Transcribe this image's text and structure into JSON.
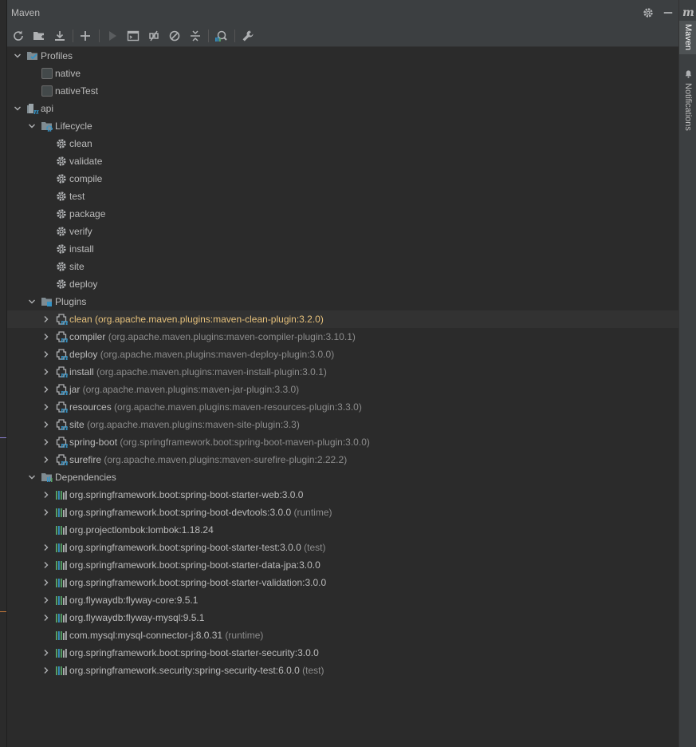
{
  "panel": {
    "title": "Maven",
    "settings_icon": "gear-icon",
    "minimize_icon": "minimize-icon"
  },
  "toolbar": [
    {
      "name": "reload-button",
      "icon": "reload-icon"
    },
    {
      "name": "add-project-button",
      "icon": "folder-add-icon"
    },
    {
      "name": "download-sources-button",
      "icon": "download-icon"
    },
    {
      "name": "add-maven-project-button",
      "icon": "plus-icon"
    },
    {
      "name": "run-button",
      "icon": "run-icon"
    },
    {
      "name": "execute-goal-button",
      "icon": "terminal-icon"
    },
    {
      "name": "toggle-offline-button",
      "icon": "offline-icon"
    },
    {
      "name": "skip-tests-button",
      "icon": "skip-tests-icon"
    },
    {
      "name": "collapse-all-button",
      "icon": "collapse-icon"
    },
    {
      "name": "show-dependencies-button",
      "icon": "dependencies-analyze-icon"
    },
    {
      "name": "build-tool-settings-button",
      "icon": "wrench-icon"
    }
  ],
  "tree": [
    {
      "label": "Profiles",
      "sub": "",
      "depth": 0,
      "expanded": true,
      "icon": "profiles-icon"
    },
    {
      "label": "native",
      "sub": "",
      "depth": 1,
      "icon": "checkbox",
      "checked": false
    },
    {
      "label": "nativeTest",
      "sub": "",
      "depth": 1,
      "icon": "checkbox",
      "checked": false
    },
    {
      "label": "api",
      "sub": "",
      "depth": 0,
      "expanded": true,
      "icon": "maven-module-icon"
    },
    {
      "label": "Lifecycle",
      "sub": "",
      "depth": 1,
      "expanded": true,
      "icon": "lifecycle-folder-icon"
    },
    {
      "label": "clean",
      "sub": "",
      "depth": 2,
      "icon": "gear-icon"
    },
    {
      "label": "validate",
      "sub": "",
      "depth": 2,
      "icon": "gear-icon"
    },
    {
      "label": "compile",
      "sub": "",
      "depth": 2,
      "icon": "gear-icon"
    },
    {
      "label": "test",
      "sub": "",
      "depth": 2,
      "icon": "gear-icon"
    },
    {
      "label": "package",
      "sub": "",
      "depth": 2,
      "icon": "gear-icon"
    },
    {
      "label": "verify",
      "sub": "",
      "depth": 2,
      "icon": "gear-icon"
    },
    {
      "label": "install",
      "sub": "",
      "depth": 2,
      "icon": "gear-icon"
    },
    {
      "label": "site",
      "sub": "",
      "depth": 2,
      "icon": "gear-icon"
    },
    {
      "label": "deploy",
      "sub": "",
      "depth": 2,
      "icon": "gear-icon"
    },
    {
      "label": "Plugins",
      "sub": "",
      "depth": 1,
      "expanded": true,
      "icon": "plugins-folder-icon"
    },
    {
      "label": "clean",
      "sub": " (org.apache.maven.plugins:maven-clean-plugin:3.2.0)",
      "depth": 2,
      "expanded": false,
      "icon": "plugin-icon",
      "selected": true
    },
    {
      "label": "compiler",
      "sub": " (org.apache.maven.plugins:maven-compiler-plugin:3.10.1)",
      "depth": 2,
      "expanded": false,
      "icon": "plugin-icon"
    },
    {
      "label": "deploy",
      "sub": " (org.apache.maven.plugins:maven-deploy-plugin:3.0.0)",
      "depth": 2,
      "expanded": false,
      "icon": "plugin-icon"
    },
    {
      "label": "install",
      "sub": " (org.apache.maven.plugins:maven-install-plugin:3.0.1)",
      "depth": 2,
      "expanded": false,
      "icon": "plugin-icon"
    },
    {
      "label": "jar",
      "sub": " (org.apache.maven.plugins:maven-jar-plugin:3.3.0)",
      "depth": 2,
      "expanded": false,
      "icon": "plugin-icon"
    },
    {
      "label": "resources",
      "sub": " (org.apache.maven.plugins:maven-resources-plugin:3.3.0)",
      "depth": 2,
      "expanded": false,
      "icon": "plugin-icon"
    },
    {
      "label": "site",
      "sub": " (org.apache.maven.plugins:maven-site-plugin:3.3)",
      "depth": 2,
      "expanded": false,
      "icon": "plugin-icon"
    },
    {
      "label": "spring-boot",
      "sub": " (org.springframework.boot:spring-boot-maven-plugin:3.0.0)",
      "depth": 2,
      "expanded": false,
      "icon": "plugin-icon"
    },
    {
      "label": "surefire",
      "sub": " (org.apache.maven.plugins:maven-surefire-plugin:2.22.2)",
      "depth": 2,
      "expanded": false,
      "icon": "plugin-icon"
    },
    {
      "label": "Dependencies",
      "sub": "",
      "depth": 1,
      "expanded": true,
      "icon": "dependencies-folder-icon"
    },
    {
      "label": "org.springframework.boot:spring-boot-starter-web:3.0.0",
      "sub": "",
      "depth": 2,
      "expanded": false,
      "icon": "library-icon"
    },
    {
      "label": "org.springframework.boot:spring-boot-devtools:3.0.0",
      "sub": " (runtime)",
      "depth": 2,
      "expanded": false,
      "icon": "library-icon"
    },
    {
      "label": "org.projectlombok:lombok:1.18.24",
      "sub": "",
      "depth": 2,
      "icon": "library-icon"
    },
    {
      "label": "org.springframework.boot:spring-boot-starter-test:3.0.0",
      "sub": " (test)",
      "depth": 2,
      "expanded": false,
      "icon": "library-icon"
    },
    {
      "label": "org.springframework.boot:spring-boot-starter-data-jpa:3.0.0",
      "sub": "",
      "depth": 2,
      "expanded": false,
      "icon": "library-icon"
    },
    {
      "label": "org.springframework.boot:spring-boot-starter-validation:3.0.0",
      "sub": "",
      "depth": 2,
      "expanded": false,
      "icon": "library-icon"
    },
    {
      "label": "org.flywaydb:flyway-core:9.5.1",
      "sub": "",
      "depth": 2,
      "expanded": false,
      "icon": "library-icon"
    },
    {
      "label": "org.flywaydb:flyway-mysql:9.5.1",
      "sub": "",
      "depth": 2,
      "expanded": false,
      "icon": "library-icon"
    },
    {
      "label": "com.mysql:mysql-connector-j:8.0.31",
      "sub": " (runtime)",
      "depth": 2,
      "icon": "library-icon"
    },
    {
      "label": "org.springframework.boot:spring-boot-starter-security:3.0.0",
      "sub": "",
      "depth": 2,
      "expanded": false,
      "icon": "library-icon"
    },
    {
      "label": "org.springframework.security:spring-security-test:6.0.0",
      "sub": " (test)",
      "depth": 2,
      "expanded": false,
      "icon": "library-icon"
    }
  ],
  "right_sidebar": {
    "app_icon": "m",
    "maven_tab": "Maven",
    "notifications_tab": "Notifications",
    "notifications_icon": "bell-icon"
  },
  "colors": {
    "background": "#2b2b2b",
    "header": "#3c3f41",
    "selected_text": "#e5c07b",
    "icon_blue": "#3592c4",
    "icon_gray": "#afb1b3"
  }
}
